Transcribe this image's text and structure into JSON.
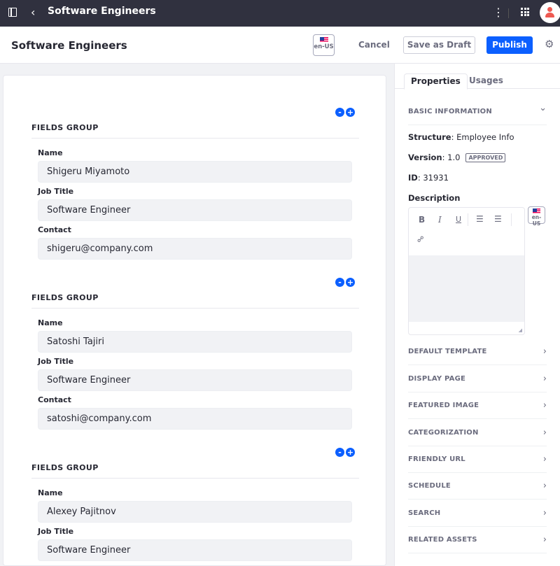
{
  "topbar": {
    "title": "Software Engineers",
    "icons": [
      "sidebar-toggle-icon",
      "back-chevron-icon",
      "kebab-menu-icon",
      "apps-grid-icon",
      "user-avatar-icon"
    ],
    "back_glyph": "‹",
    "kebab_glyph": "⋮"
  },
  "header": {
    "title": "Software Engineers",
    "language": "en-US",
    "cancel_label": "Cancel",
    "draft_label": "Save as Draft",
    "publish_label": "Publish",
    "gear_glyph": "⚙"
  },
  "colors": {
    "accent": "#0b5fff",
    "topbar": "#30313f",
    "input_bg": "#f1f2f5"
  },
  "groups": [
    {
      "title": "FIELDS GROUP",
      "remove_glyph": "-",
      "add_glyph": "+",
      "fields": [
        {
          "label": "Name",
          "value": "Shigeru Miyamoto"
        },
        {
          "label": "Job Title",
          "value": "Software Engineer"
        },
        {
          "label": "Contact",
          "value": "shigeru@company.com"
        }
      ]
    },
    {
      "title": "FIELDS GROUP",
      "remove_glyph": "-",
      "add_glyph": "+",
      "fields": [
        {
          "label": "Name",
          "value": "Satoshi Tajiri"
        },
        {
          "label": "Job Title",
          "value": "Software Engineer"
        },
        {
          "label": "Contact",
          "value": "satoshi@company.com"
        }
      ]
    },
    {
      "title": "FIELDS GROUP",
      "remove_glyph": "-",
      "add_glyph": "+",
      "fields": [
        {
          "label": "Name",
          "value": "Alexey Pajitnov"
        },
        {
          "label": "Job Title",
          "value": "Software Engineer"
        }
      ]
    }
  ],
  "sidebar": {
    "tabs": [
      {
        "label": "Properties"
      },
      {
        "label": "Usages"
      }
    ],
    "basic": {
      "title": "BASIC INFORMATION",
      "chevron": "⌄",
      "structure_label": "Structure",
      "structure_value": ": Employee Info",
      "version_label": "Version",
      "version_value": ": 1.0",
      "status_badge": "APPROVED",
      "id_label": "ID",
      "id_value": ": 31931",
      "description_label": "Description",
      "description_language": "en-US"
    },
    "editor_tools": {
      "bold": "B",
      "italic": "I",
      "underline": "U",
      "ordered_list": "☰",
      "unordered_list": "☰",
      "link": "🔗",
      "resize": "◢"
    },
    "sections": [
      {
        "label": "DEFAULT TEMPLATE"
      },
      {
        "label": "DISPLAY PAGE"
      },
      {
        "label": "FEATURED IMAGE"
      },
      {
        "label": "CATEGORIZATION"
      },
      {
        "label": "FRIENDLY URL"
      },
      {
        "label": "SCHEDULE"
      },
      {
        "label": "SEARCH"
      },
      {
        "label": "RELATED ASSETS"
      }
    ],
    "section_chevron": "›"
  }
}
